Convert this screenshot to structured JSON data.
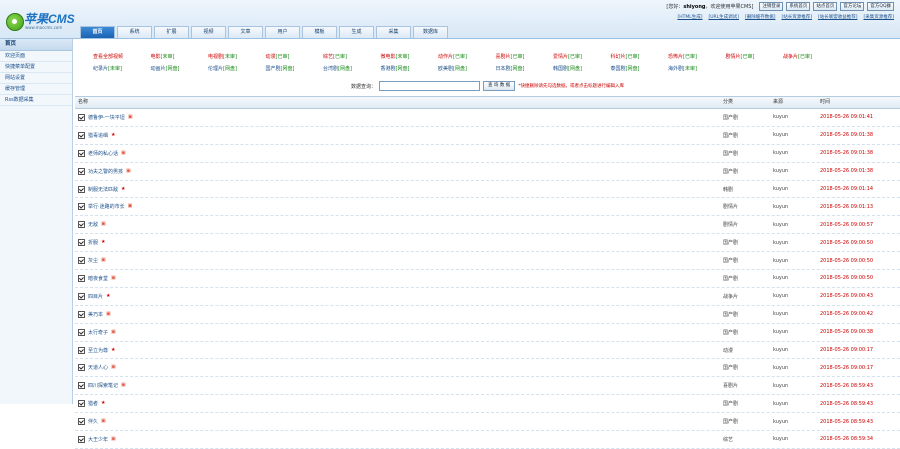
{
  "header": {
    "logo_text": "苹果CMS",
    "logo_sub": "www.maccms.com",
    "welcome_prefix": "[您好：",
    "username": "shiyong",
    "welcome_suffix": "，欢迎使用苹果CMS]",
    "user_buttons": [
      "注销登录",
      "系统首页",
      "站点首页",
      "官方论坛",
      "官方QQ群"
    ],
    "quick_links": [
      "[HTML生成]",
      "[URL生成调试]",
      "[删除缓存数据]",
      "[站长资源推荐]",
      "[站长联盟收益推荐]",
      "[采集资源推荐]"
    ],
    "tabs": [
      {
        "label": "首页",
        "active": true
      },
      {
        "label": "系统",
        "active": false
      },
      {
        "label": "扩展",
        "active": false
      },
      {
        "label": "视频",
        "active": false
      },
      {
        "label": "文章",
        "active": false
      },
      {
        "label": "用户",
        "active": false
      },
      {
        "label": "模板",
        "active": false
      },
      {
        "label": "生成",
        "active": false
      },
      {
        "label": "采集",
        "active": false
      },
      {
        "label": "数据库",
        "active": false
      }
    ]
  },
  "sidebar": {
    "title": "首页",
    "items": [
      "欢迎页面",
      "快捷菜单配置",
      "网站设置",
      "缓存管理",
      "Rss数据采集"
    ]
  },
  "filters": {
    "row1": [
      {
        "label": "查看全部视频",
        "count": ""
      },
      {
        "label": "电影",
        "count": "[未审]"
      },
      {
        "label": "电视剧",
        "count": "[未审]"
      },
      {
        "label": "动漫",
        "count": "[已审]"
      },
      {
        "label": "综艺",
        "count": "[已审]"
      },
      {
        "label": "微电影",
        "count": "[未审]"
      },
      {
        "label": "动作片",
        "count": "[已审]"
      },
      {
        "label": "喜剧片",
        "count": "[已审]"
      },
      {
        "label": "爱情片",
        "count": "[已审]"
      },
      {
        "label": "科幻片",
        "count": "[已审]"
      },
      {
        "label": "恐怖片",
        "count": "[已审]"
      },
      {
        "label": "剧情片",
        "count": "[已审]"
      },
      {
        "label": "战争片",
        "count": "[已审]"
      }
    ],
    "row2": [
      {
        "label": "纪录片",
        "count": "[未审]"
      },
      {
        "label": "动画片",
        "count": "[网盘]"
      },
      {
        "label": "伦理片",
        "count": "[网盘]"
      },
      {
        "label": "国产剧",
        "count": "[网盘]"
      },
      {
        "label": "台湾剧",
        "count": "[网盘]"
      },
      {
        "label": "香港剧",
        "count": "[网盘]"
      },
      {
        "label": "欧美剧",
        "count": "[网盘]"
      },
      {
        "label": "日本剧",
        "count": "[网盘]"
      },
      {
        "label": "韩国剧",
        "count": "[网盘]"
      },
      {
        "label": "泰国剧",
        "count": "[网盘]"
      },
      {
        "label": "海外剧",
        "count": "[未审]"
      }
    ]
  },
  "search": {
    "label": "数据查询：",
    "placeholder": "",
    "button": "查 询 数 据",
    "hint": "*快捷删除请先勾选数据，或者点击标题进行编辑入库"
  },
  "table": {
    "headers": {
      "name": "名称",
      "type": "分类",
      "source": "来源",
      "time": "时间"
    },
    "state_icon": "hot-star-icon",
    "rows": [
      {
        "name": "德鲁伊-一块平坦",
        "state": "荐",
        "type": "国产剧",
        "source": "kuyun",
        "time": "2018-05-26 09:01:41"
      },
      {
        "name": "猎毒追缉",
        "state": "荐",
        "type": "国产剧",
        "source": "kuyun",
        "time": "2018-05-26 09:01:38"
      },
      {
        "name": "老师的私心话",
        "state": "荐",
        "type": "国产剧",
        "source": "kuyun",
        "time": "2018-05-26 09:01:38"
      },
      {
        "name": "功夫之警的男孩",
        "state": "荐",
        "type": "国产剧",
        "source": "kuyun",
        "time": "2018-05-26 09:01:38"
      },
      {
        "name": "制服无法匹敌",
        "state": "荐",
        "type": "韩剧",
        "source": "kuyun",
        "time": "2018-05-26 09:01:14"
      },
      {
        "name": "举行·迷路的市长",
        "state": "荐",
        "type": "剧情片",
        "source": "kuyun",
        "time": "2018-05-26 09:01:13"
      },
      {
        "name": "无敌",
        "state": "荐",
        "type": "剧情片",
        "source": "kuyun",
        "time": "2018-05-26 09:00:57"
      },
      {
        "name": "折服",
        "state": "荐",
        "type": "国产剧",
        "source": "kuyun",
        "time": "2018-05-26 09:00:50"
      },
      {
        "name": "灰尘",
        "state": "荐",
        "type": "国产剧",
        "source": "kuyun",
        "time": "2018-05-26 09:00:50"
      },
      {
        "name": "暗夜食堂",
        "state": "荐",
        "type": "国产剧",
        "source": "kuyun",
        "time": "2018-05-26 09:00:50"
      },
      {
        "name": "四目片",
        "state": "荐",
        "type": "战争片",
        "source": "kuyun",
        "time": "2018-05-26 09:00:43"
      },
      {
        "name": "美巧本",
        "state": "荐",
        "type": "国产剧",
        "source": "kuyun",
        "time": "2018-05-26 09:00:42"
      },
      {
        "name": "太行奇子",
        "state": "荐",
        "type": "国产剧",
        "source": "kuyun",
        "time": "2018-05-26 09:00:38"
      },
      {
        "name": "至立为尊",
        "state": "荐",
        "type": "动漫",
        "source": "kuyun",
        "time": "2018-05-26 09:00:17"
      },
      {
        "name": "天道人心",
        "state": "荐",
        "type": "国产剧",
        "source": "kuyun",
        "time": "2018-05-26 09:00:17"
      },
      {
        "name": "四川探索笔记",
        "state": "荐",
        "type": "喜剧片",
        "source": "kuyun",
        "time": "2018-05-26 08:59:43"
      },
      {
        "name": "猎者",
        "state": "荐",
        "type": "国产剧",
        "source": "kuyun",
        "time": "2018-05-26 08:59:43"
      },
      {
        "name": "伴久",
        "state": "荐",
        "type": "国产剧",
        "source": "kuyun",
        "time": "2018-05-26 08:59:43"
      },
      {
        "name": "大王少年",
        "state": "荐",
        "type": "综艺",
        "source": "kuyun",
        "time": "2018-05-26 08:59:34"
      }
    ]
  }
}
